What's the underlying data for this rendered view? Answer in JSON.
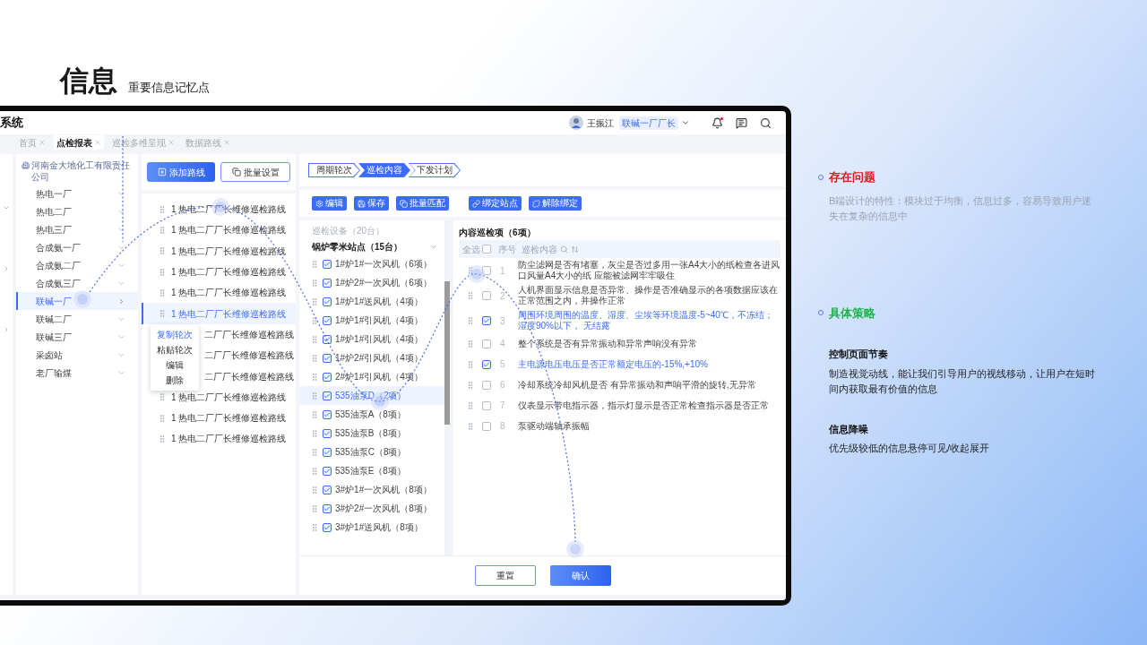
{
  "slide": {
    "title": "信息",
    "subtitle": "重要信息记忆点"
  },
  "app": {
    "title": "系统",
    "user": {
      "name": "王振江",
      "role": "联碱一厂厂长"
    },
    "unread": true
  },
  "tabs": [
    {
      "label": "首页",
      "selected": false
    },
    {
      "label": "点检报表",
      "selected": true
    },
    {
      "label": "巡检多维呈现",
      "selected": false
    },
    {
      "label": "数据路线",
      "selected": false
    }
  ],
  "org_tree": {
    "company": "河南金大地化工有限责任公司",
    "items": [
      {
        "label": "热电一厂",
        "selected": false
      },
      {
        "label": "热电二厂",
        "selected": false
      },
      {
        "label": "热电三厂",
        "selected": false
      },
      {
        "label": "合成氨一厂",
        "selected": false
      },
      {
        "label": "合成氨二厂",
        "selected": false
      },
      {
        "label": "合成氨三厂",
        "selected": false
      },
      {
        "label": "联碱一厂",
        "selected": true
      },
      {
        "label": "联碱二厂",
        "selected": false
      },
      {
        "label": "联碱三厂",
        "selected": false
      },
      {
        "label": "采卤站",
        "selected": false
      },
      {
        "label": "老厂输煤",
        "selected": false
      }
    ]
  },
  "routes": {
    "buttons": [
      {
        "label": "添加路线",
        "kind": "primary"
      },
      {
        "label": "批量设置",
        "kind": "outline"
      }
    ],
    "items": [
      {
        "index": "1",
        "label": "热电二厂厂长维修巡检路线",
        "selected": false
      },
      {
        "index": "1",
        "label": "热电二厂厂长维修巡检路线",
        "selected": false
      },
      {
        "index": "1",
        "label": "热电二厂厂长维修巡检路线",
        "selected": false
      },
      {
        "index": "1",
        "label": "热电二厂厂长维修巡检路线",
        "selected": false
      },
      {
        "index": "1",
        "label": "热电二厂厂长维修巡检路线",
        "selected": false
      },
      {
        "index": "1",
        "label": "热电二厂厂长维修巡检路线",
        "selected": true
      },
      {
        "label": "二厂厂长维修巡检路线",
        "selected": false
      },
      {
        "label": "二厂厂长维修巡检路线",
        "selected": false
      },
      {
        "label": "二厂厂长维修巡检路线",
        "selected": false
      },
      {
        "index": "1",
        "label": "热电二厂厂长维修巡检路线",
        "selected": false
      },
      {
        "index": "1",
        "label": "热电二厂厂长维修巡检路线",
        "selected": false
      },
      {
        "index": "1",
        "label": "热电二厂厂长维修巡检路线",
        "selected": false
      }
    ],
    "context_menu": [
      {
        "label": "复制轮次",
        "selected": true
      },
      {
        "label": "粘贴轮次",
        "selected": false
      },
      {
        "label": "编辑",
        "selected": false
      },
      {
        "label": "删除",
        "selected": false
      }
    ]
  },
  "steps": [
    {
      "label": "周期轮次",
      "selected": false
    },
    {
      "label": "巡检内容",
      "selected": true
    },
    {
      "label": "下发计划",
      "selected": false
    }
  ],
  "toolbar": [
    "编辑",
    "保存",
    "批量匹配",
    "绑定站点",
    "解除绑定"
  ],
  "devices": {
    "caption": "巡检设备（20台）",
    "group": "锅炉零米站点（15台）",
    "expanded": true,
    "items": [
      {
        "label": "1#炉1#一次风机（6项）",
        "checked": true,
        "selected": false
      },
      {
        "label": "1#炉2#一次风机（6项）",
        "checked": true,
        "selected": false
      },
      {
        "label": "1#炉1#送风机（4项）",
        "checked": true,
        "selected": false
      },
      {
        "label": "1#炉1#引风机（4项）",
        "checked": true,
        "selected": false
      },
      {
        "label": "1#炉1#引风机（4项）",
        "checked": true,
        "selected": false
      },
      {
        "label": "1#炉2#引风机（4项）",
        "checked": true,
        "selected": false
      },
      {
        "label": "2#炉1#引风机（4项）",
        "checked": true,
        "selected": false
      },
      {
        "label": "535油泵D（2项）",
        "checked": true,
        "selected": true
      },
      {
        "label": "535油泵A（8项）",
        "checked": true,
        "selected": false
      },
      {
        "label": "535油泵B（8项）",
        "checked": true,
        "selected": false
      },
      {
        "label": "535油泵C（8项）",
        "checked": true,
        "selected": false
      },
      {
        "label": "535油泵E（8项）",
        "checked": true,
        "selected": false
      },
      {
        "label": "3#炉1#一次风机（8项）",
        "checked": true,
        "selected": false
      },
      {
        "label": "3#炉2#一次风机（8项）",
        "checked": true,
        "selected": false
      },
      {
        "label": "3#炉1#送风机（8项）",
        "checked": true,
        "selected": false
      }
    ]
  },
  "content": {
    "title": "内容巡检项（6项）",
    "select_all_label": "全选",
    "select_all": false,
    "number_label": "序号",
    "content_label": "巡检内容",
    "rows": [
      {
        "number": "1",
        "text": "防尘滤网是否有堵塞，灰尘是否过多用一张A4大小的纸检查各进风口风量A4大小的纸 应能被滤网牢牢吸住",
        "checked": false
      },
      {
        "number": "2",
        "text": "人机界面显示信息是否异常、操作是否准确显示的各项数据应该在正常范围之内，并操作正常",
        "checked": false
      },
      {
        "number": "3",
        "text": "周围环境周围的温度、湿度、尘埃等环境温度-5~40℃，不冻结；湿度90%以下， 无结露",
        "checked": true
      },
      {
        "number": "4",
        "text": "整个系统是否有异常振动和异常声响没有异常",
        "checked": false
      },
      {
        "number": "5",
        "text": "主电源电压电压是否正常额定电压的-15%,+10%",
        "checked": true
      },
      {
        "number": "6",
        "text": "冷却系统冷却风机是否 有异常振动和声响平滑的旋转,无异常",
        "checked": false
      },
      {
        "number": "7",
        "text": "仪表显示带电指示器，指示灯显示是否正常检查指示器是否正常",
        "checked": false
      },
      {
        "number": "8",
        "text": "泵驱动端轴承振幅",
        "checked": false
      }
    ]
  },
  "footer_buttons": [
    {
      "label": "重置",
      "kind": "outline"
    },
    {
      "label": "确认",
      "kind": "primary"
    }
  ],
  "notes": [
    {
      "heading": "存在问题",
      "color": "#e3191c",
      "body": "B端设计的特性：模块过于均衡，信息过多，容易导致用户迷失在复杂的信息中"
    },
    {
      "heading": "具体策略",
      "color": "#1fb24a",
      "points": [
        {
          "title": "控制页面节奏",
          "text": "制造视觉动线，能让我们引导用户的视线移动，让用户在短时间内获取最有价值的信息"
        },
        {
          "title": "信息降噪",
          "text": "优先级较低的信息悬停可见/收起展开"
        }
      ]
    }
  ]
}
